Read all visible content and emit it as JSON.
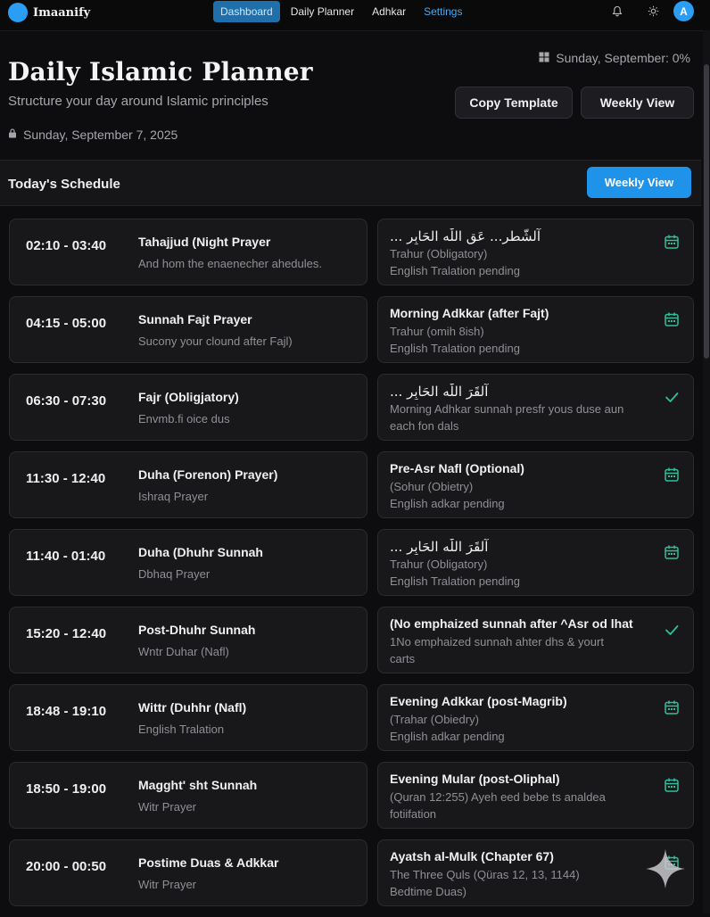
{
  "nav": {
    "brand": "Imaanify",
    "links": [
      {
        "label": "Dashboard",
        "active": true
      },
      {
        "label": "Daily Planner",
        "active": false
      },
      {
        "label": "Adhkar",
        "active": false
      },
      {
        "label": "Settings",
        "active": false
      }
    ],
    "icons": [
      "bell-icon",
      "sun-icon"
    ],
    "avatar": "A",
    "accent_color": "#2a9df4"
  },
  "header": {
    "title": "Daily Islamic Planner",
    "subtitle": "Structure your day around Islamic principles",
    "date": "Sunday, September 7, 2025",
    "top_right_date": "Sunday, September: 0%",
    "copy_template_label": "Copy Template",
    "weekly_view_label": "Weekly View"
  },
  "section": {
    "title": "Today's Schedule",
    "weekly_view_label": "Weekly View"
  },
  "schedule": [
    {
      "time": "02:10 - 03:40",
      "name": "Tahajjud (Night Prayer",
      "sub": "And hom the enaenecher ahedules.",
      "right_title": "... آلشّطر... عَق اللّٰه الحَابِر",
      "right_arabic": true,
      "line1": "Trahur (Obligatory)",
      "line2": "English Tralation pending",
      "status": "calendar"
    },
    {
      "time": "04:15 - 05:00",
      "name": "Sunnah Fajt Prayer",
      "sub": "Sucony your clound after Fajl)",
      "right_title": "Morning Adkkar (after Fajt)",
      "right_arabic": false,
      "line1": "Trahur (omih 8ish)",
      "line2": "English Tralation pending",
      "status": "calendar"
    },
    {
      "time": "06:30 - 07:30",
      "name": "Fajr (Obligjatory)",
      "sub": "Envmb.fi oice dus",
      "right_title": "... آلقَرَ اللّٰه الحَابِر",
      "right_arabic": true,
      "line1": "Morning Adhkar sunnah presfr yous duse aun",
      "line2": "each fon dals",
      "status": "check"
    },
    {
      "time": "11:30 - 12:40",
      "name": "Duha (Forenon) Prayer)",
      "sub": "Ishraq Prayer",
      "right_title": "Pre-Asr Nafl (Optional)",
      "right_arabic": false,
      "line1": "(Sohur (Obietry)",
      "line2": "English adkar pending",
      "status": "calendar"
    },
    {
      "time": "11:40 - 01:40",
      "name": "Duha (Dhuhr Sunnah",
      "sub": "Dbhaq Prayer",
      "right_title": "... آلقَرَ اللّٰه الحَابِر",
      "right_arabic": true,
      "line1": "Trahur (Obligatory)",
      "line2": "English Tralation pending",
      "status": "calendar"
    },
    {
      "time": "15:20 - 12:40",
      "name": "Post-Dhuhr Sunnah",
      "sub": "Wntr Duhar (Nafl)",
      "right_title": "(No emphaized sunnah after ^Asr od lhat",
      "right_arabic": false,
      "line1": "1No emphaized sunnah ahter dhs & yourt",
      "line2": "carts",
      "status": "check"
    },
    {
      "time": "18:48 - 19:10",
      "name": "Wittr (Duhhr (Nafl)",
      "sub": "English Tralation",
      "right_title": "Evening Adkkar (post-Magrib)",
      "right_arabic": false,
      "line1": "(Trahar (Obiedry)",
      "line2": "English adkar pending",
      "status": "calendar"
    },
    {
      "time": "18:50 - 19:00",
      "name": "Magght' sht Sunnah",
      "sub": "Witr Prayer",
      "right_title": "Evening Mular (post-Oliphal)",
      "right_arabic": false,
      "line1": "(Quran 12:255) Ayeh eed bebe ts analdea",
      "line2": "fotiifation",
      "status": "calendar"
    },
    {
      "time": "20:00 - 00:50",
      "name": "Postime Duas & Adkkar",
      "sub": "Witr Prayer",
      "right_title": "Ayatsh al-Mulk (Chapter 67)",
      "right_arabic": false,
      "line1": "The Three Quls (Qüras 12, 13, 1144)",
      "line2": "Bedtime Duas)",
      "status": "calendar"
    }
  ],
  "colors": {
    "status_green": "#2fbf9a",
    "button_blue": "#1f92ea"
  }
}
